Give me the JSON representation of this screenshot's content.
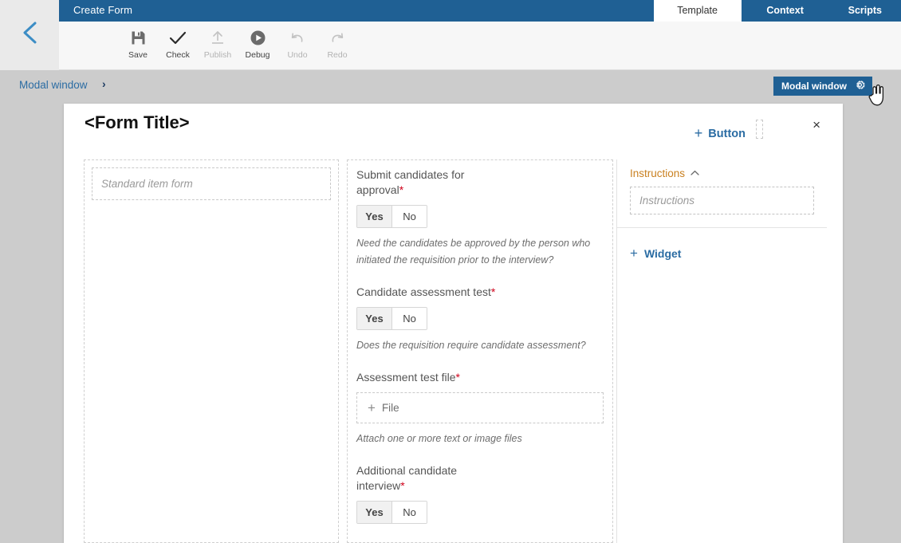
{
  "app": {
    "title": "Create Form",
    "back_icon": "chevron-left-icon"
  },
  "tabs": [
    {
      "label": "Template",
      "active": true
    },
    {
      "label": "Context",
      "active": false
    },
    {
      "label": "Scripts",
      "active": false
    }
  ],
  "toolbar": [
    {
      "label": "Save",
      "icon": "save-icon",
      "disabled": false
    },
    {
      "label": "Check",
      "icon": "check-icon",
      "disabled": false
    },
    {
      "label": "Publish",
      "icon": "upload-icon",
      "disabled": true
    },
    {
      "label": "Debug",
      "icon": "play-circle-icon",
      "disabled": false
    },
    {
      "label": "Undo",
      "icon": "undo-icon",
      "disabled": true
    },
    {
      "label": "Redo",
      "icon": "redo-icon",
      "disabled": true
    }
  ],
  "breadcrumb": {
    "item": "Modal window",
    "separator": "›"
  },
  "modal_chip": {
    "label": "Modal window",
    "icon": "gear-icon"
  },
  "cursor": "pointer-hand-cursor",
  "form": {
    "title": "<Form Title>",
    "add_button": {
      "plus": "+",
      "label": "Button"
    },
    "close": "×",
    "left_column": {
      "placeholder": "Standard item form"
    },
    "fields": [
      {
        "label": "Submit candidates for approval",
        "required": true,
        "type": "yesno",
        "options": [
          "Yes",
          "No"
        ],
        "selected": "Yes",
        "hint": "Need the candidates be approved by the person who initiated the requisition prior to the interview?"
      },
      {
        "label": "Candidate assessment test",
        "required": true,
        "type": "yesno",
        "options": [
          "Yes",
          "No"
        ],
        "selected": "Yes",
        "hint": "Does the requisition require candidate assessment?"
      },
      {
        "label": "Assessment test file",
        "required": true,
        "type": "file",
        "dropzone_label": "File",
        "dropzone_plus": "+",
        "hint": "Attach one or more text or image files"
      },
      {
        "label": "Additional candidate interview",
        "required": true,
        "type": "yesno",
        "options": [
          "Yes",
          "No"
        ],
        "selected": "Yes",
        "hint": ""
      }
    ],
    "right_pane": {
      "instructions_header": "Instructions",
      "instructions_caret": "⌃",
      "instructions_placeholder": "Instructions",
      "add_widget": {
        "plus": "+",
        "label": "Widget"
      }
    }
  },
  "colors": {
    "header_blue": "#1f6094",
    "link_blue": "#2b6ca3",
    "required_red": "#d0021b",
    "pane_header_orange": "#c98020",
    "page_bg": "#cccccc",
    "rail_gray": "#eaeaea"
  }
}
